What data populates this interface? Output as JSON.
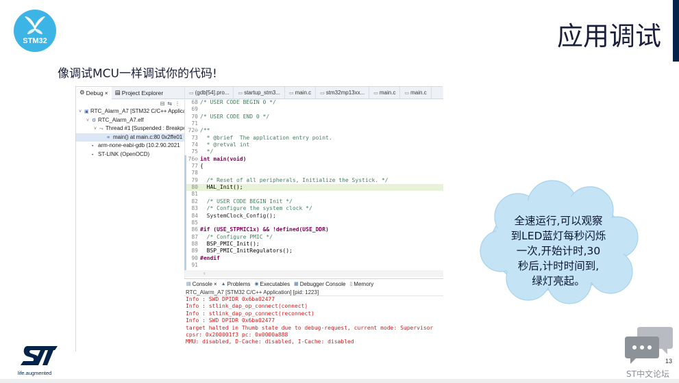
{
  "brand": {
    "logo_text": "STM32",
    "tagline": "life.augmented",
    "colors": {
      "stm_blue": "#3cb4e5",
      "navy": "#03234b",
      "cloud": "#c4e4f5",
      "console_red": "#d21d1d"
    }
  },
  "slide": {
    "title": "应用调试",
    "subtitle": "像调试MCU一样调试你的代码!",
    "page_number": "13",
    "forum_label": "ST中文论坛"
  },
  "ide": {
    "debug_tabs": [
      {
        "label": "Debug",
        "icon": "debug-icon"
      },
      {
        "label": "Project Explorer",
        "icon": "project-explorer-icon"
      }
    ],
    "debug_tree": [
      {
        "label": "RTC_Alarm_A7 [STM32 C/C++ Application]",
        "indent": 0,
        "arrow": "˅",
        "icon": "launch-icon"
      },
      {
        "label": "RTC_Alarm_A7.elf",
        "indent": 1,
        "arrow": "˅",
        "icon": "elf-icon"
      },
      {
        "label": "Thread #1 [Suspended : Breakpoint]",
        "indent": 2,
        "arrow": "˅",
        "icon": "thread-icon"
      },
      {
        "label": "main() at main.c:80 0x2ffe01",
        "indent": 3,
        "arrow": "",
        "icon": "stack-frame-icon",
        "selected": true
      },
      {
        "label": "arm-none-eabi-gdb (10.2.90.2021",
        "indent": 1,
        "arrow": "",
        "icon": "gdb-icon"
      },
      {
        "label": "ST-LINK (OpenOCD)",
        "indent": 1,
        "arrow": "",
        "icon": "stlink-icon"
      }
    ],
    "editor_tabs": [
      {
        "label": "(gdb[54].pro...",
        "icon": "file-icon"
      },
      {
        "label": "startup_stm3...",
        "icon": "file-icon"
      },
      {
        "label": "main.c",
        "icon": "file-icon"
      },
      {
        "label": "stm32mp13xx...",
        "icon": "file-icon"
      },
      {
        "label": "main.c",
        "icon": "file-icon"
      },
      {
        "label": "main.c",
        "icon": "file-icon"
      }
    ],
    "code_lines": [
      {
        "n": "68",
        "t": "/* USER CODE BEGIN 0 */",
        "cls": "cm"
      },
      {
        "n": "69",
        "t": "",
        "cls": ""
      },
      {
        "n": "70",
        "t": "/* USER CODE END 0 */",
        "cls": "cm"
      },
      {
        "n": "71",
        "t": "",
        "cls": ""
      },
      {
        "n": "72⊖",
        "t": "/**",
        "cls": "cm"
      },
      {
        "n": "73",
        "t": "  * @brief  The application entry point.",
        "cls": "cm"
      },
      {
        "n": "74",
        "t": "  * @retval int",
        "cls": "cm"
      },
      {
        "n": "75",
        "t": "  */",
        "cls": "cm"
      },
      {
        "n": "76⊖",
        "t": "int main(void)",
        "cls": "kw"
      },
      {
        "n": "77",
        "t": "{",
        "cls": ""
      },
      {
        "n": "78",
        "t": "",
        "cls": ""
      },
      {
        "n": "79",
        "t": "  /* Reset of all peripherals, Initialize the Systick. */",
        "cls": "cm"
      },
      {
        "n": "80",
        "t": "  HAL_Init();",
        "cls": "fn",
        "hl": true
      },
      {
        "n": "81",
        "t": "",
        "cls": ""
      },
      {
        "n": "82",
        "t": "  /* USER CODE BEGIN Init */",
        "cls": "cm"
      },
      {
        "n": "83",
        "t": "  /* Configure the system clock */",
        "cls": "cm"
      },
      {
        "n": "84",
        "t": "  SystemClock_Config();",
        "cls": ""
      },
      {
        "n": "85",
        "t": "",
        "cls": ""
      },
      {
        "n": "86",
        "t": "#if (USE_STPMIC1x) && !defined(USE_DDR)",
        "cls": "kw"
      },
      {
        "n": "87",
        "t": "  /* Configure PMIC */",
        "cls": "cm"
      },
      {
        "n": "88",
        "t": "  BSP_PMIC_Init();",
        "cls": "fn"
      },
      {
        "n": "89",
        "t": "  BSP_PMIC_InitRegulators();",
        "cls": "fn"
      },
      {
        "n": "90",
        "t": "#endif",
        "cls": "kw"
      },
      {
        "n": "91",
        "t": "",
        "cls": ""
      }
    ],
    "console_tabs": [
      {
        "label": "Console",
        "icon": "console-icon"
      },
      {
        "label": "Problems",
        "icon": "problems-icon"
      },
      {
        "label": "Executables",
        "icon": "executables-icon"
      },
      {
        "label": "Debugger Console",
        "icon": "debugger-console-icon"
      },
      {
        "label": "Memory",
        "icon": "memory-icon"
      }
    ],
    "console_header": "RTC_Alarm_A7 [STM32 C/C++ Application] [pid: 1223]",
    "console_lines": [
      "Info : SWD DPIDR 0x6ba02477",
      "Info : stlink_dap_op_connect(connect)",
      "Info : stlink_dap_op_connect(reconnect)",
      "Info : SWD DPIDR 0x6ba02477",
      "target halted in Thumb state due to debug-request, current mode: Supervisor",
      "cpsr: 0x200001f3 pc: 0x0000a888",
      "MMU: disabled, D-Cache: disabled, I-Cache: disabled"
    ]
  },
  "callout": {
    "lines": [
      "全速运行,可以观察",
      "到LED蓝灯每秒闪烁",
      "一次,开始计时,30",
      "秒后,计时时间到,",
      "绿灯亮起。"
    ]
  }
}
